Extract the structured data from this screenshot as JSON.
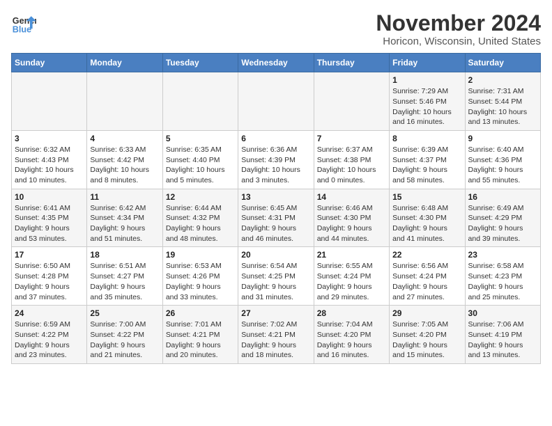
{
  "header": {
    "logo_line1": "General",
    "logo_line2": "Blue",
    "month_title": "November 2024",
    "location": "Horicon, Wisconsin, United States"
  },
  "weekdays": [
    "Sunday",
    "Monday",
    "Tuesday",
    "Wednesday",
    "Thursday",
    "Friday",
    "Saturday"
  ],
  "weeks": [
    [
      {
        "day": "",
        "info": ""
      },
      {
        "day": "",
        "info": ""
      },
      {
        "day": "",
        "info": ""
      },
      {
        "day": "",
        "info": ""
      },
      {
        "day": "",
        "info": ""
      },
      {
        "day": "1",
        "info": "Sunrise: 7:29 AM\nSunset: 5:46 PM\nDaylight: 10 hours\nand 16 minutes."
      },
      {
        "day": "2",
        "info": "Sunrise: 7:31 AM\nSunset: 5:44 PM\nDaylight: 10 hours\nand 13 minutes."
      }
    ],
    [
      {
        "day": "3",
        "info": "Sunrise: 6:32 AM\nSunset: 4:43 PM\nDaylight: 10 hours\nand 10 minutes."
      },
      {
        "day": "4",
        "info": "Sunrise: 6:33 AM\nSunset: 4:42 PM\nDaylight: 10 hours\nand 8 minutes."
      },
      {
        "day": "5",
        "info": "Sunrise: 6:35 AM\nSunset: 4:40 PM\nDaylight: 10 hours\nand 5 minutes."
      },
      {
        "day": "6",
        "info": "Sunrise: 6:36 AM\nSunset: 4:39 PM\nDaylight: 10 hours\nand 3 minutes."
      },
      {
        "day": "7",
        "info": "Sunrise: 6:37 AM\nSunset: 4:38 PM\nDaylight: 10 hours\nand 0 minutes."
      },
      {
        "day": "8",
        "info": "Sunrise: 6:39 AM\nSunset: 4:37 PM\nDaylight: 9 hours\nand 58 minutes."
      },
      {
        "day": "9",
        "info": "Sunrise: 6:40 AM\nSunset: 4:36 PM\nDaylight: 9 hours\nand 55 minutes."
      }
    ],
    [
      {
        "day": "10",
        "info": "Sunrise: 6:41 AM\nSunset: 4:35 PM\nDaylight: 9 hours\nand 53 minutes."
      },
      {
        "day": "11",
        "info": "Sunrise: 6:42 AM\nSunset: 4:34 PM\nDaylight: 9 hours\nand 51 minutes."
      },
      {
        "day": "12",
        "info": "Sunrise: 6:44 AM\nSunset: 4:32 PM\nDaylight: 9 hours\nand 48 minutes."
      },
      {
        "day": "13",
        "info": "Sunrise: 6:45 AM\nSunset: 4:31 PM\nDaylight: 9 hours\nand 46 minutes."
      },
      {
        "day": "14",
        "info": "Sunrise: 6:46 AM\nSunset: 4:30 PM\nDaylight: 9 hours\nand 44 minutes."
      },
      {
        "day": "15",
        "info": "Sunrise: 6:48 AM\nSunset: 4:30 PM\nDaylight: 9 hours\nand 41 minutes."
      },
      {
        "day": "16",
        "info": "Sunrise: 6:49 AM\nSunset: 4:29 PM\nDaylight: 9 hours\nand 39 minutes."
      }
    ],
    [
      {
        "day": "17",
        "info": "Sunrise: 6:50 AM\nSunset: 4:28 PM\nDaylight: 9 hours\nand 37 minutes."
      },
      {
        "day": "18",
        "info": "Sunrise: 6:51 AM\nSunset: 4:27 PM\nDaylight: 9 hours\nand 35 minutes."
      },
      {
        "day": "19",
        "info": "Sunrise: 6:53 AM\nSunset: 4:26 PM\nDaylight: 9 hours\nand 33 minutes."
      },
      {
        "day": "20",
        "info": "Sunrise: 6:54 AM\nSunset: 4:25 PM\nDaylight: 9 hours\nand 31 minutes."
      },
      {
        "day": "21",
        "info": "Sunrise: 6:55 AM\nSunset: 4:24 PM\nDaylight: 9 hours\nand 29 minutes."
      },
      {
        "day": "22",
        "info": "Sunrise: 6:56 AM\nSunset: 4:24 PM\nDaylight: 9 hours\nand 27 minutes."
      },
      {
        "day": "23",
        "info": "Sunrise: 6:58 AM\nSunset: 4:23 PM\nDaylight: 9 hours\nand 25 minutes."
      }
    ],
    [
      {
        "day": "24",
        "info": "Sunrise: 6:59 AM\nSunset: 4:22 PM\nDaylight: 9 hours\nand 23 minutes."
      },
      {
        "day": "25",
        "info": "Sunrise: 7:00 AM\nSunset: 4:22 PM\nDaylight: 9 hours\nand 21 minutes."
      },
      {
        "day": "26",
        "info": "Sunrise: 7:01 AM\nSunset: 4:21 PM\nDaylight: 9 hours\nand 20 minutes."
      },
      {
        "day": "27",
        "info": "Sunrise: 7:02 AM\nSunset: 4:21 PM\nDaylight: 9 hours\nand 18 minutes."
      },
      {
        "day": "28",
        "info": "Sunrise: 7:04 AM\nSunset: 4:20 PM\nDaylight: 9 hours\nand 16 minutes."
      },
      {
        "day": "29",
        "info": "Sunrise: 7:05 AM\nSunset: 4:20 PM\nDaylight: 9 hours\nand 15 minutes."
      },
      {
        "day": "30",
        "info": "Sunrise: 7:06 AM\nSunset: 4:19 PM\nDaylight: 9 hours\nand 13 minutes."
      }
    ]
  ]
}
